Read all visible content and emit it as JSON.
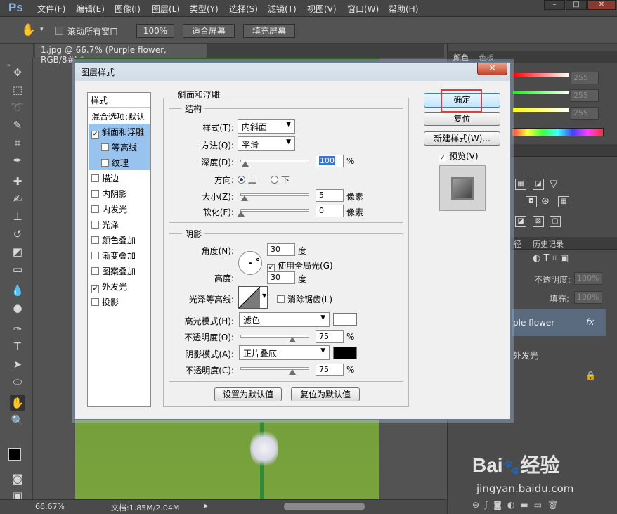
{
  "app": {
    "logo": "Ps"
  },
  "menu": [
    "文件(F)",
    "编辑(E)",
    "图像(I)",
    "图层(L)",
    "类型(Y)",
    "选择(S)",
    "滤镜(T)",
    "视图(V)",
    "窗口(W)",
    "帮助(H)"
  ],
  "window_controls": [
    "–",
    "□",
    "✕"
  ],
  "options_bar": {
    "scroll_all_label": "滚动所有窗口",
    "zoom_btn": "100%",
    "fit_btn": "适合屏幕",
    "fill_btn": "填充屏幕"
  },
  "document_tab": {
    "title": "1.jpg @ 66.7% (Purple flower, RGB/8#) *",
    "close": "×"
  },
  "status_bar": {
    "zoom": "66.67%",
    "doc_info": "文档:1.85M/2.04M"
  },
  "right_panel": {
    "tabs": [
      "颜色",
      "色板"
    ],
    "color_values": [
      "255",
      "255",
      "255"
    ],
    "history_tab": "历史记录",
    "history_tab_partial": "径",
    "opacity_label": "不透明度:",
    "opacity_value": "100%",
    "fill_label": "填充:",
    "fill_value": "100%",
    "layer_name": "ple flower",
    "fx_label": "fx",
    "effect_name": "外发光"
  },
  "dialog": {
    "title": "图层样式",
    "close": "✕",
    "style_list": {
      "header": "样式",
      "items": [
        {
          "label": "混合选项:默认",
          "checkbox": false,
          "checked": false,
          "selected": false,
          "sub": false
        },
        {
          "label": "斜面和浮雕",
          "checkbox": true,
          "checked": true,
          "selected": true,
          "sub": false
        },
        {
          "label": "等高线",
          "checkbox": true,
          "checked": false,
          "selected": true,
          "sub": true
        },
        {
          "label": "纹理",
          "checkbox": true,
          "checked": false,
          "selected": true,
          "sub": true
        },
        {
          "label": "描边",
          "checkbox": true,
          "checked": false,
          "selected": false,
          "sub": false
        },
        {
          "label": "内阴影",
          "checkbox": true,
          "checked": false,
          "selected": false,
          "sub": false
        },
        {
          "label": "内发光",
          "checkbox": true,
          "checked": false,
          "selected": false,
          "sub": false
        },
        {
          "label": "光泽",
          "checkbox": true,
          "checked": false,
          "selected": false,
          "sub": false
        },
        {
          "label": "颜色叠加",
          "checkbox": true,
          "checked": false,
          "selected": false,
          "sub": false
        },
        {
          "label": "渐变叠加",
          "checkbox": true,
          "checked": false,
          "selected": false,
          "sub": false
        },
        {
          "label": "图案叠加",
          "checkbox": true,
          "checked": false,
          "selected": false,
          "sub": false
        },
        {
          "label": "外发光",
          "checkbox": true,
          "checked": true,
          "selected": false,
          "sub": false
        },
        {
          "label": "投影",
          "checkbox": true,
          "checked": false,
          "selected": false,
          "sub": false
        }
      ]
    },
    "bevel": {
      "group_title": "斜面和浮雕",
      "structure_title": "结构",
      "style_label": "样式(T):",
      "style_value": "内斜面",
      "technique_label": "方法(Q):",
      "technique_value": "平滑",
      "depth_label": "深度(D):",
      "depth_value": "100",
      "depth_unit": "%",
      "direction_label": "方向:",
      "direction_up": "上",
      "direction_down": "下",
      "direction_selected": "up",
      "size_label": "大小(Z):",
      "size_value": "5",
      "size_unit": "像素",
      "soften_label": "软化(F):",
      "soften_value": "0",
      "soften_unit": "像素"
    },
    "shading": {
      "title": "阴影",
      "angle_label": "角度(N):",
      "angle_value": "30",
      "angle_unit": "度",
      "global_light_label": "使用全局光(G)",
      "global_light_checked": true,
      "altitude_label": "高度:",
      "altitude_value": "30",
      "altitude_unit": "度",
      "gloss_label": "光泽等高线:",
      "antialias_label": "消除锯齿(L)",
      "antialias_checked": false,
      "highlight_mode_label": "高光模式(H):",
      "highlight_mode_value": "滤色",
      "highlight_color": "#ffffff",
      "highlight_opacity_label": "不透明度(O):",
      "highlight_opacity_value": "75",
      "highlight_opacity_unit": "%",
      "shadow_mode_label": "阴影模式(A):",
      "shadow_mode_value": "正片叠底",
      "shadow_color": "#000000",
      "shadow_opacity_label": "不透明度(C):",
      "shadow_opacity_value": "75",
      "shadow_opacity_unit": "%"
    },
    "make_default_btn": "设置为默认值",
    "reset_default_btn": "复位为默认值",
    "ok_btn": "确定",
    "reset_btn": "复位",
    "new_style_btn": "新建样式(W)...",
    "preview_label": "预览(V)",
    "preview_checked": true
  },
  "watermark": {
    "text": "Bai",
    "text2": "经验",
    "url": "jingyan.baidu.com"
  },
  "colors": {
    "highlight_box": "#e03c3c",
    "dialog_bg": "#f0f0f0",
    "list_selected": "#99c3ef"
  }
}
